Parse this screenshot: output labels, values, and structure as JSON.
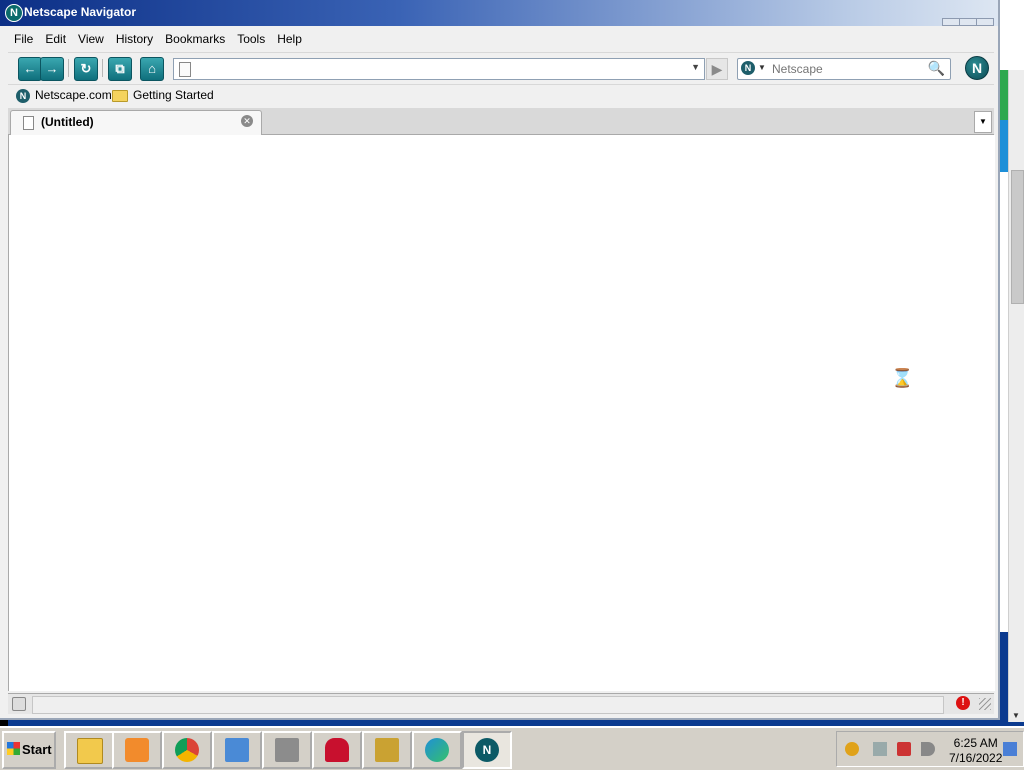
{
  "window": {
    "title": "Netscape Navigator",
    "logo_letter": "N"
  },
  "menu": {
    "file": "File",
    "edit": "Edit",
    "view": "View",
    "history": "History",
    "bookmarks": "Bookmarks",
    "tools": "Tools",
    "help": "Help"
  },
  "navbar": {
    "url_value": "",
    "search_placeholder": "Netscape"
  },
  "bookmarks_bar": {
    "items": [
      {
        "label": "Netscape.com",
        "icon": "netscape-icon"
      },
      {
        "label": "Getting Started",
        "icon": "folder-icon"
      }
    ]
  },
  "tabs": [
    {
      "label": "(Untitled)",
      "active": true
    }
  ],
  "taskbar": {
    "start_label": "Start",
    "apps": [
      {
        "name": "file-explorer-icon",
        "color": "#f2c94c"
      },
      {
        "name": "media-player-icon",
        "color": "#f28b2c"
      },
      {
        "name": "chrome-icon",
        "color": "#2b9a48"
      },
      {
        "name": "control-panel-icon",
        "color": "#4a8ad6"
      },
      {
        "name": "printer-icon",
        "color": "#8c8c8c"
      },
      {
        "name": "hearts-icon",
        "color": "#c8102e"
      },
      {
        "name": "solitaire-icon",
        "color": "#caa232"
      },
      {
        "name": "edge-icon",
        "color": "#1f8fd6"
      },
      {
        "name": "netscape-icon",
        "color": "#0c5a66"
      }
    ],
    "clock_time": "6:25 AM",
    "clock_date": "7/16/2022"
  }
}
